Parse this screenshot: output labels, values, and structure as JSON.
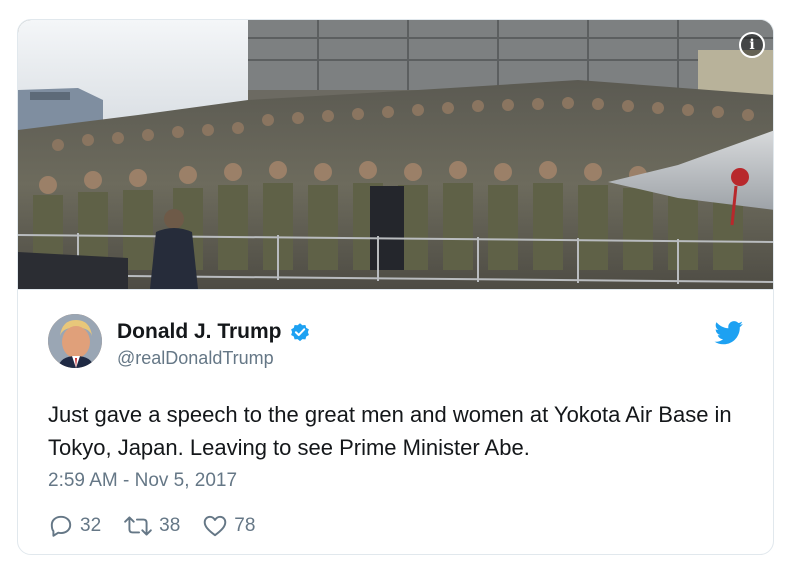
{
  "tweet": {
    "display_name": "Donald J. Trump",
    "handle": "@realDonaldTrump",
    "verified": true,
    "text": "Just gave a speech to the great men and women at Yokota Air Base in Tokyo, Japan. Leaving to see Prime Minister Abe.",
    "timestamp": "2:59 AM - Nov 5, 2017",
    "replies": "32",
    "retweets": "38",
    "likes": "78"
  },
  "media": {
    "info_label": "i",
    "description_icon": "photo-troops-in-hangar"
  },
  "icons": {
    "verified": "verified-badge-icon",
    "brand": "twitter-bird-icon",
    "reply": "reply-icon",
    "retweet": "retweet-icon",
    "like": "heart-icon"
  },
  "colors": {
    "brand_blue": "#1da1f2",
    "text_primary": "#14171a",
    "text_secondary": "#657786",
    "border": "#e1e8ed"
  }
}
